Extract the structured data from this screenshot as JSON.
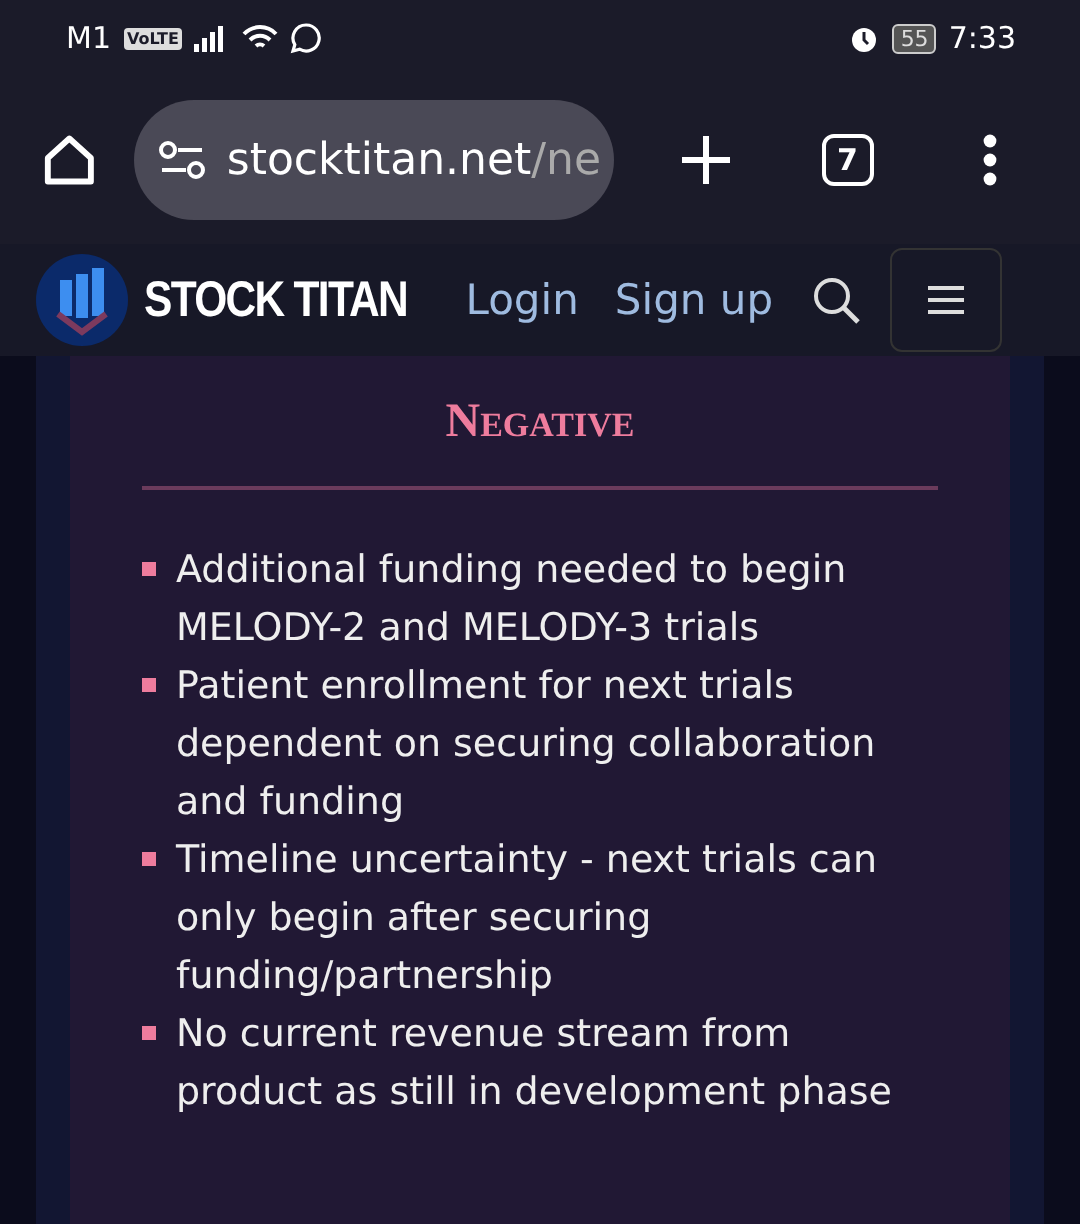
{
  "status_bar": {
    "carrier": "M1",
    "network_badge": "VoLTE",
    "battery": "55",
    "time": "7:33"
  },
  "browser": {
    "url_host": "stocktitan.net",
    "url_path": "/ne",
    "tab_count": "7"
  },
  "site_header": {
    "brand": "STOCK TITAN",
    "links": [
      "Login",
      "Sign up"
    ]
  },
  "card": {
    "title": "Negative",
    "items": [
      "Additional funding needed to begin MELODY-2 and MELODY-3 trials",
      "Patient enrollment for next trials dependent on securing collaboration and funding",
      "Timeline uncertainty - next trials can only begin after securing funding/partnership",
      "No current revenue stream from product as still in development phase"
    ]
  }
}
